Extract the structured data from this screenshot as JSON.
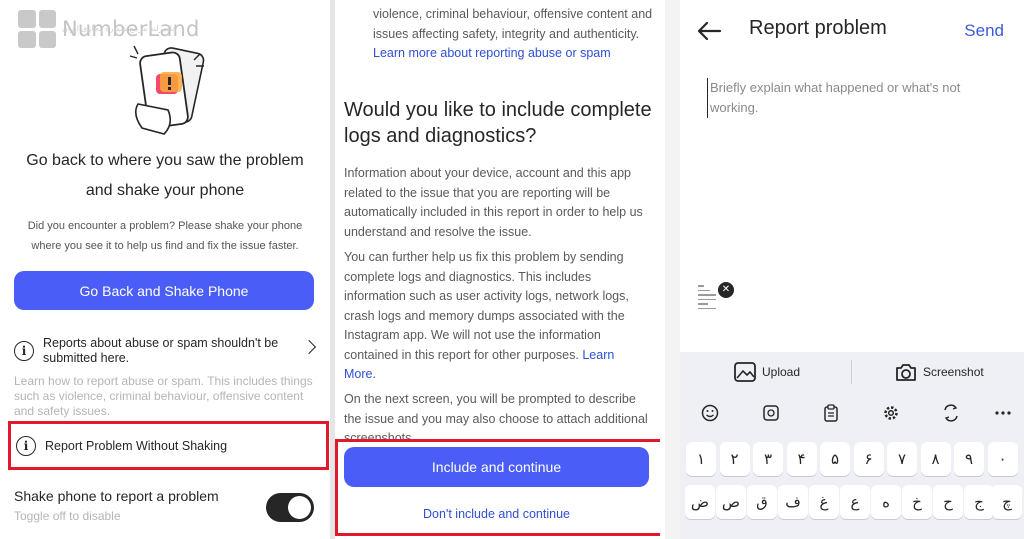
{
  "panel1": {
    "logo_text": "NumberLand",
    "logo_subtitle": "نامبرلند مرجع شماره مجازی ایران",
    "title_line1": "Go back to where you saw the problem",
    "title_line2": "and shake your phone",
    "description": "Did you encounter a problem? Please shake your phone where you see it to help us find and fix the issue faster.",
    "primary_button": "Go Back and Shake Phone",
    "abuse_row": "Reports about abuse or spam shouldn't be submitted here.",
    "abuse_learn": "Learn how to report abuse or spam. This includes things such as violence, criminal behaviour, offensive content and safety issues.",
    "report_without_shaking": "Report Problem Without Shaking",
    "shake_title": "Shake phone to report a problem",
    "shake_subtitle": "Toggle off to disable",
    "toggle_on": true
  },
  "panel2": {
    "top_text": "violence, criminal behaviour, offensive content and issues affecting safety, integrity and authenticity.",
    "top_link": "Learn more about reporting abuse or spam",
    "heading": "Would you like to include complete logs and diagnostics?",
    "para1": "Information about your device, account and this app related to the issue that you are reporting will be automatically included in this report in order to help us understand and resolve the issue.",
    "para2": "You can further help us fix this problem by sending complete logs and diagnostics. This includes information such as user activity logs, network logs, crash logs and memory dumps associated with the Instagram app. We will not use the information contained in this report for other purposes.",
    "para2_link": "Learn More.",
    "para3": "On the next screen, you will be prompted to describe the issue and you may also choose to attach additional screenshots.",
    "primary_button": "Include and continue",
    "secondary_button": "Don't include and continue"
  },
  "panel3": {
    "title": "Report problem",
    "send": "Send",
    "input_placeholder": "Briefly explain what happened or what's not working.",
    "upload": "Upload",
    "screenshot": "Screenshot",
    "keyboard": {
      "digits": [
        "۱",
        "۲",
        "۳",
        "۴",
        "۵",
        "۶",
        "۷",
        "۸",
        "۹",
        "۰"
      ],
      "row2": [
        "ض",
        "ص",
        "ق",
        "ف",
        "غ",
        "ع",
        "ه",
        "خ",
        "ح",
        "ج",
        "چ"
      ]
    }
  },
  "colors": {
    "accent_button": "#4a5ef7",
    "link": "#2e4fd6",
    "highlight_box": "#e0192d"
  }
}
